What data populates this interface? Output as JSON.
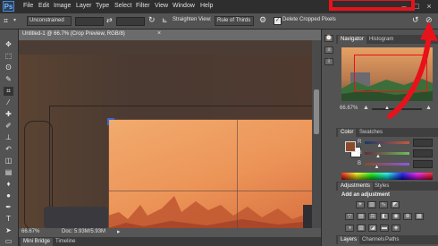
{
  "app": {
    "logo": "Ps"
  },
  "menu": {
    "items": [
      "File",
      "Edit",
      "Image",
      "Layer",
      "Type",
      "Select",
      "Filter",
      "View",
      "Window",
      "Help"
    ]
  },
  "window_controls": {
    "minimize": "–",
    "maximize": "□",
    "close": "×"
  },
  "options_bar": {
    "ratio_value": "Unconstrained",
    "straighten_label": "Straighten",
    "view_label": "View:",
    "view_value": "Rule of Thirds",
    "delete_cropped_label": "Delete Cropped Pixels",
    "delete_cropped_checked": true
  },
  "document": {
    "tab_title": "Untitled-1 @ 66.7% (Crop Preview, RGB/8)",
    "close_glyph": "×",
    "zoom": "66.67%",
    "doc_info": "Doc: 5.93M/5.93M"
  },
  "bottom_tabs": [
    "Mini Bridge",
    "Timeline"
  ],
  "panels": {
    "navigator": {
      "tabs": [
        "Navigator",
        "Histogram"
      ],
      "zoom": "66.67%"
    },
    "color": {
      "tabs": [
        "Color",
        "Swatches"
      ],
      "channels": [
        {
          "label": "R",
          "value": "",
          "level": 0.33
        },
        {
          "label": "G",
          "value": "",
          "level": 0.3
        },
        {
          "label": "B",
          "value": "",
          "level": 0.27
        }
      ],
      "foreground": "#8b4a2c",
      "background": "#ffffff"
    },
    "adjustments": {
      "tabs": [
        "Adjustments",
        "Styles"
      ],
      "heading": "Add an adjustment"
    },
    "layers": {
      "tabs": [
        "Layers",
        "Channels",
        "Paths"
      ]
    }
  },
  "colors": {
    "annotation_red": "#e8121a",
    "crop_sky": "#f0a063",
    "crop_ground": "#d86a3d"
  }
}
